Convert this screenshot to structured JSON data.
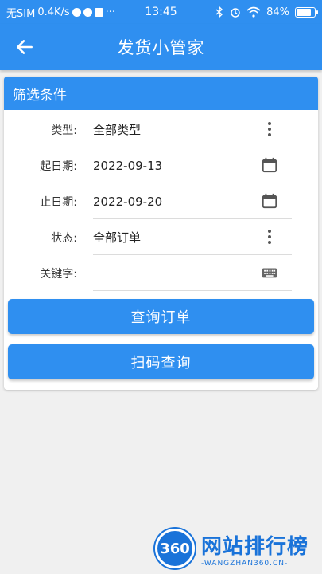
{
  "status_bar": {
    "carrier": "无SIM",
    "speed": "0.4K/s",
    "dots": "···",
    "time": "13:45",
    "battery_text": "84%",
    "battery_level": 0.84
  },
  "app_bar": {
    "title": "发货小管家",
    "back_icon": "arrow-left-icon"
  },
  "filter": {
    "header": "筛选条件",
    "fields": [
      {
        "label": "类型:",
        "value": "全部类型",
        "icon": "more-vert-icon"
      },
      {
        "label": "起日期:",
        "value": "2022-09-13",
        "icon": "calendar-icon"
      },
      {
        "label": "止日期:",
        "value": "2022-09-20",
        "icon": "calendar-icon"
      },
      {
        "label": "状态:",
        "value": "全部订单",
        "icon": "more-vert-icon"
      },
      {
        "label": "关键字:",
        "value": "",
        "icon": "keyboard-icon"
      }
    ]
  },
  "buttons": {
    "query": "查询订单",
    "scan": "扫码查询"
  },
  "watermark": {
    "logo": "360",
    "main": "网站排行榜",
    "sub": "-WANGZHAN360.CN-"
  },
  "colors": {
    "primary": "#2f8ff0",
    "background": "#f0f0f0",
    "watermark": "#1a73d9"
  }
}
